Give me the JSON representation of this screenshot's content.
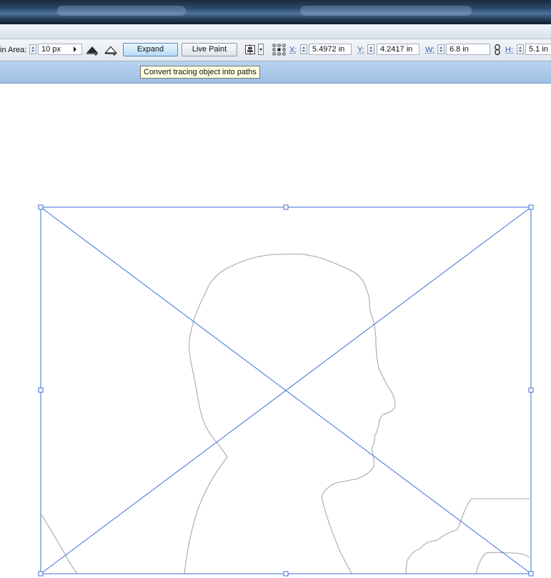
{
  "control_bar": {
    "min_area_label": "in Area:",
    "min_area_value": "10 px",
    "expand_label": "Expand",
    "live_paint_label": "Live Paint",
    "x_label": "X:",
    "x_value": "5.4972 in",
    "y_label": "Y:",
    "y_value": "4.2417 in",
    "w_label": "W:",
    "w_value": "6.8 in",
    "h_label": "H:",
    "h_value": "5.1 in"
  },
  "tooltip": {
    "text": "Convert tracing object into paths"
  },
  "icons": {
    "raster_view": "raster-view-icon",
    "vector_view": "vector-view-icon",
    "align": "align-icon",
    "reference_point": "reference-point-icon",
    "constrain": "link-proportions-icon"
  },
  "colors": {
    "selection": "#3c6fd6",
    "trace_outline": "#a8a8a8",
    "hot_button": "#b9dcf6",
    "tooltip_bg": "#ffffe1"
  }
}
